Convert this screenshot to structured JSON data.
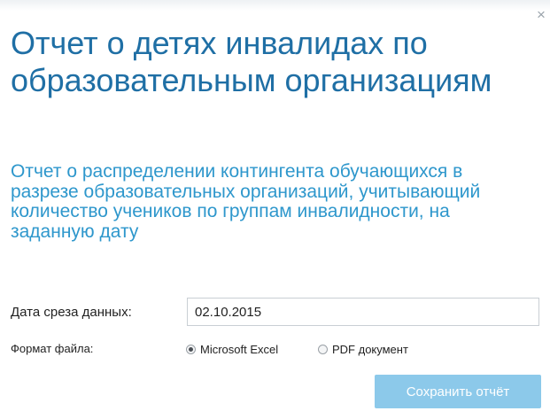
{
  "dialog": {
    "close_glyph": "×",
    "title": "Отчет о детях инвалидах по образовательным организациям",
    "subtitle": "Отчет о распределении контингента обучающихся в разрезе образовательных организаций, учитывающий количество учеников по группам инвалидности, на заданную дату"
  },
  "form": {
    "date_label": "Дата среза данных:",
    "date_value": "02.10.2015",
    "format_label": "Формат файла:",
    "format_options": [
      {
        "label": "Microsoft Excel",
        "selected": true
      },
      {
        "label": "PDF документ",
        "selected": false
      }
    ]
  },
  "actions": {
    "save_label": "Сохранить отчёт"
  },
  "colors": {
    "title": "#1f6fa5",
    "subtitle": "#2e97cc",
    "button_bg": "#8cc9ea"
  }
}
